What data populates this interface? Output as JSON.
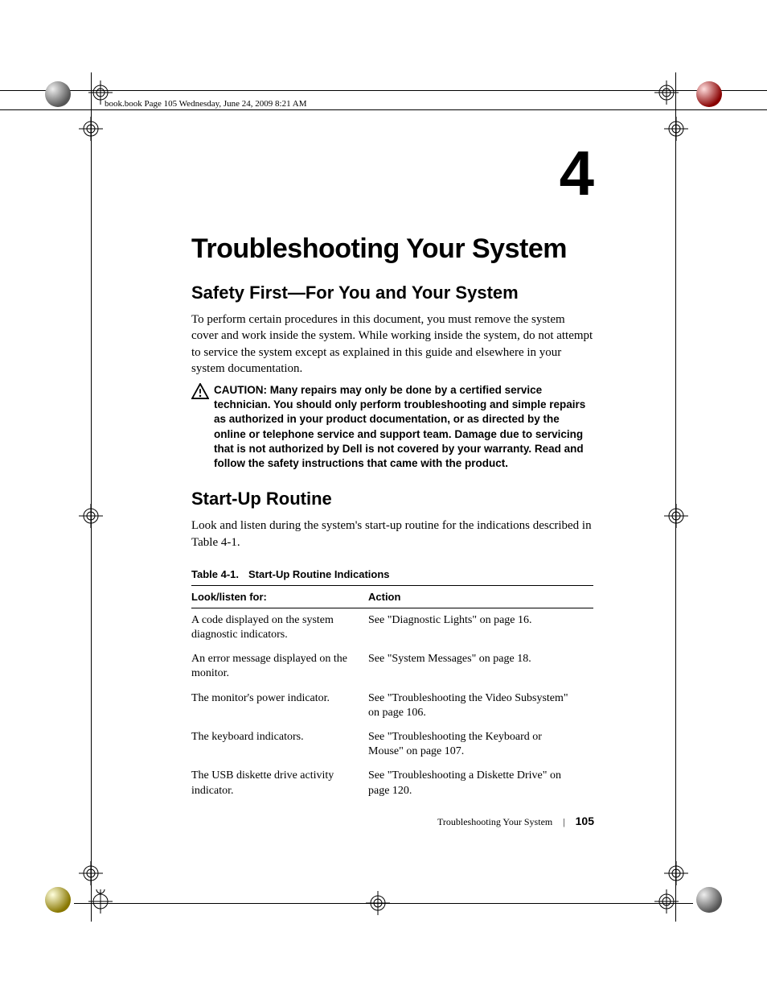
{
  "header_line": "book.book  Page 105  Wednesday, June 24, 2009  8:21 AM",
  "chapter_number": "4",
  "title": "Troubleshooting Your System",
  "section_safety_heading": "Safety First—For You and Your System",
  "section_safety_body": "To perform certain procedures in this document, you must remove the system cover and work inside the system. While working inside the system, do not attempt to service the system except as explained in this guide and elsewhere in your system documentation.",
  "caution_label": "CAUTION: ",
  "caution_text": "Many repairs may only be done by a certified service technician. You should only perform troubleshooting and simple repairs as authorized in your product documentation, or as directed by the online or telephone service and support team. Damage due to servicing that is not authorized by Dell is not covered by your warranty. Read and follow the safety instructions that came with the product.",
  "section_startup_heading": "Start-Up Routine",
  "section_startup_body": "Look and listen during the system's start-up routine for the indications described in Table 4-1.",
  "table_caption_label": "Table 4-1.",
  "table_caption_title": "Start-Up Routine Indications",
  "table": {
    "header": {
      "col1": "Look/listen for:",
      "col2": "Action"
    },
    "rows": [
      {
        "look": "A code displayed on the system diagnostic indicators.",
        "action": "See \"Diagnostic Lights\" on page 16."
      },
      {
        "look": "An error message displayed on the monitor.",
        "action": "See \"System Messages\" on page 18."
      },
      {
        "look": "The monitor's power indicator.",
        "action": "See \"Troubleshooting the Video Subsystem\" on page 106."
      },
      {
        "look": "The keyboard indicators.",
        "action": "See \"Troubleshooting the Keyboard or Mouse\" on page 107."
      },
      {
        "look": "The USB diskette drive activity indicator.",
        "action": "See \"Troubleshooting a Diskette Drive\" on page 120."
      }
    ]
  },
  "footer_text": "Troubleshooting Your System",
  "footer_page": "105"
}
